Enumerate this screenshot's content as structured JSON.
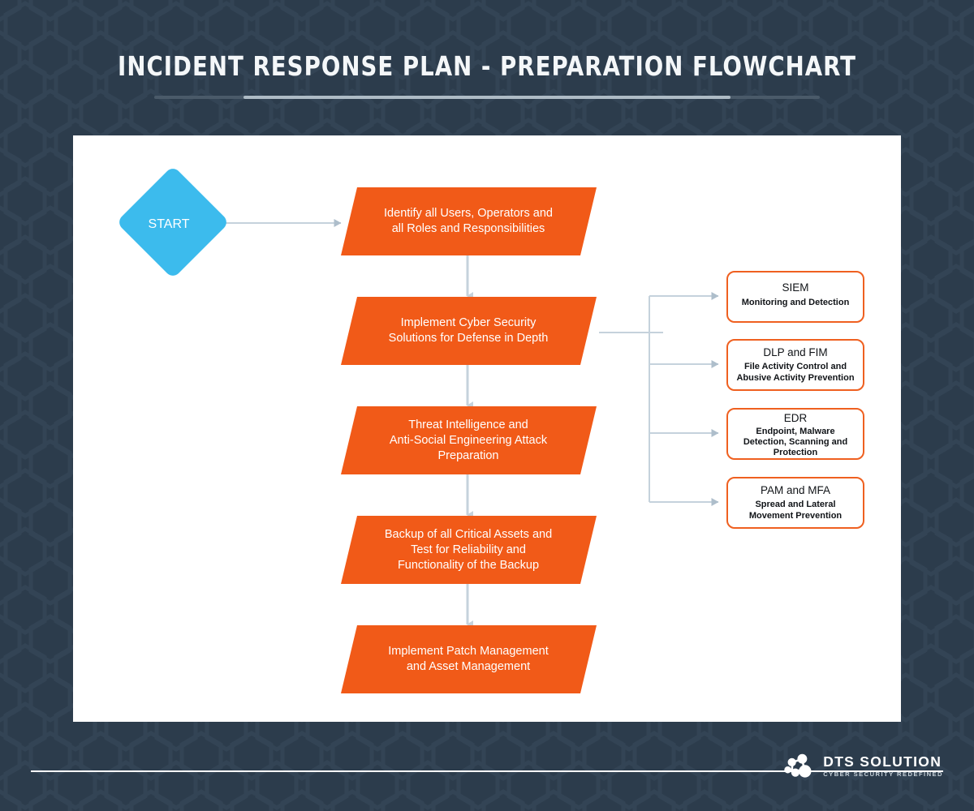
{
  "header": {
    "title": "INCIDENT RESPONSE PLAN - PREPARATION FLOWCHART"
  },
  "colors": {
    "background": "#2c3c4c",
    "panel": "#ffffff",
    "orange": "#f15a18",
    "cyan": "#3cbbed",
    "connector": "#c5d2dc",
    "side_border": "#ef6020",
    "text_light": "#ffffff",
    "text_dark": "#111418",
    "rule_bright": "#aebbc5",
    "rule_dim": "#4a5a69"
  },
  "flow": {
    "start": {
      "label": "START",
      "shape": "diamond"
    },
    "steps": [
      {
        "id": "step-identify-users",
        "shape": "parallelogram",
        "lines": [
          "Identify all Users, Operators and",
          "all Roles and Responsibilities"
        ]
      },
      {
        "id": "step-implement-security-solutions",
        "shape": "parallelogram",
        "lines": [
          "Implement Cyber Security",
          "Solutions for Defense in Depth"
        ]
      },
      {
        "id": "step-threat-intelligence",
        "shape": "parallelogram",
        "lines": [
          "Threat Intelligence and",
          "Anti-Social Engineering Attack",
          "Preparation"
        ]
      },
      {
        "id": "step-backup-critical-assets",
        "shape": "parallelogram",
        "lines": [
          "Backup of all Critical Assets and",
          "Test for Reliability and",
          "Functionality of the Backup"
        ]
      },
      {
        "id": "step-patch-asset-management",
        "shape": "parallelogram",
        "lines": [
          "Implement Patch Management",
          "and Asset Management"
        ]
      }
    ],
    "branches": [
      {
        "id": "branch-siem",
        "title": "SIEM",
        "subtitle_lines": [
          "Monitoring and Detection"
        ]
      },
      {
        "id": "branch-dlp-fim",
        "title": "DLP and FIM",
        "subtitle_lines": [
          "File Activity Control and",
          "Abusive Activity Prevention"
        ]
      },
      {
        "id": "branch-edr",
        "title": "EDR",
        "subtitle_lines": [
          "Endpoint, Malware",
          "Detection, Scanning and",
          "Protection"
        ]
      },
      {
        "id": "branch-pam-mfa",
        "title": "PAM and MFA",
        "subtitle_lines": [
          "Spread and Lateral",
          "Movement Prevention"
        ]
      }
    ]
  },
  "footer": {
    "logo_name": "DTS SOLUTION",
    "logo_tagline": "CYBER SECURITY REDEFINED"
  }
}
